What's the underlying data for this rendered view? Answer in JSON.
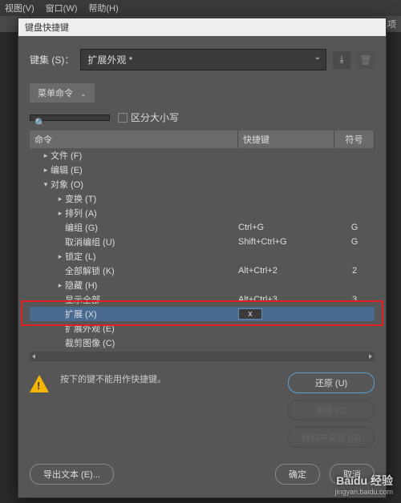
{
  "menubar": {
    "view": "视图(V)",
    "window": "窗口(W)",
    "help": "帮助(H)"
  },
  "right_label": "首选项",
  "dialog": {
    "title": "键盘快捷键",
    "set_label": "键集 (S)：",
    "set_value": "扩展外观 *",
    "tab_label": "菜单命令",
    "search_placeholder": "",
    "case_label": "区分大小写",
    "headers": {
      "cmd": "命令",
      "shortcut": "快捷键",
      "symbol": "符号"
    },
    "tree": [
      {
        "label": "文件 (F)",
        "level": 1,
        "expand": "right"
      },
      {
        "label": "编辑 (E)",
        "level": 1,
        "expand": "right"
      },
      {
        "label": "对象 (O)",
        "level": 1,
        "expand": "down"
      },
      {
        "label": "变换 (T)",
        "level": 2,
        "expand": "right"
      },
      {
        "label": "排列 (A)",
        "level": 2,
        "expand": "right"
      },
      {
        "label": "编组 (G)",
        "level": 2,
        "sc": "Ctrl+G",
        "sy": "G"
      },
      {
        "label": "取消编组 (U)",
        "level": 2,
        "sc": "Shift+Ctrl+G",
        "sy": "G"
      },
      {
        "label": "锁定 (L)",
        "level": 2,
        "expand": "right"
      },
      {
        "label": "全部解锁 (K)",
        "level": 2,
        "sc": "Alt+Ctrl+2",
        "sy": "2"
      },
      {
        "label": "隐藏 (H)",
        "level": 2,
        "expand": "right"
      },
      {
        "label": "显示全部",
        "level": 2,
        "sc": "Alt+Ctrl+3",
        "sy": "3"
      },
      {
        "label": "扩展 (X)",
        "level": 2,
        "selected": true,
        "input": "x"
      },
      {
        "label": "扩展外观 (E)",
        "level": 2
      },
      {
        "label": "裁剪图像 (C)",
        "level": 2
      }
    ],
    "warning": "按下的键不能用作快捷键。",
    "buttons": {
      "undo": "还原 (U)",
      "clear": "清除 (C)",
      "goto": "转到冲突处 (G)",
      "export": "导出文本 (E)...",
      "ok": "确定",
      "cancel": "取消"
    }
  },
  "watermark": {
    "brand": "Baidu 经验",
    "url": "jingyan.baidu.com"
  }
}
